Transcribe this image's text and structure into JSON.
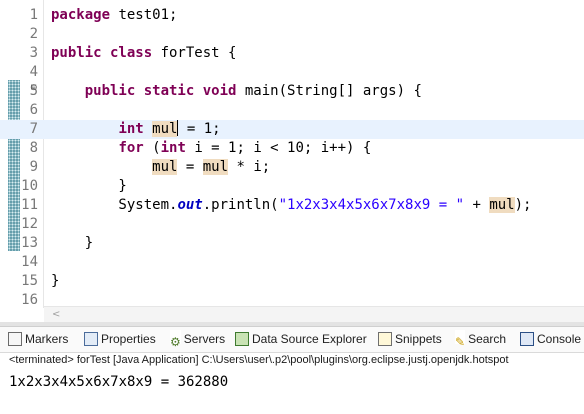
{
  "editor": {
    "lines": [
      {
        "n": "1",
        "parts": [
          {
            "t": "package ",
            "c": "kw"
          },
          {
            "t": "test01;"
          }
        ]
      },
      {
        "n": "2",
        "parts": []
      },
      {
        "n": "3",
        "parts": [
          {
            "t": "public class ",
            "c": "kw"
          },
          {
            "t": "forTest {"
          }
        ]
      },
      {
        "n": "4",
        "parts": []
      },
      {
        "n": "5",
        "fold": "⊖",
        "parts": [
          {
            "t": "    "
          },
          {
            "t": "public static void ",
            "c": "kw"
          },
          {
            "t": "main(String[] args) {"
          }
        ]
      },
      {
        "n": "6",
        "parts": []
      },
      {
        "n": "7",
        "current": true,
        "parts": [
          {
            "t": "        "
          },
          {
            "t": "int ",
            "c": "kw"
          },
          {
            "t": "mul",
            "c": "occ",
            "caret": true
          },
          {
            "t": " = 1;"
          }
        ]
      },
      {
        "n": "8",
        "parts": [
          {
            "t": "        "
          },
          {
            "t": "for ",
            "c": "kw"
          },
          {
            "t": "("
          },
          {
            "t": "int ",
            "c": "kw"
          },
          {
            "t": "i = 1; i < 10; i++) {"
          }
        ]
      },
      {
        "n": "9",
        "parts": [
          {
            "t": "            "
          },
          {
            "t": "mul",
            "c": "occ"
          },
          {
            "t": " = "
          },
          {
            "t": "mul",
            "c": "occ"
          },
          {
            "t": " * i;"
          }
        ]
      },
      {
        "n": "10",
        "parts": [
          {
            "t": "        }"
          }
        ]
      },
      {
        "n": "11",
        "parts": [
          {
            "t": "        System."
          },
          {
            "t": "out",
            "c": "fld"
          },
          {
            "t": ".println("
          },
          {
            "t": "\"1x2x3x4x5x6x7x8x9 = \"",
            "c": "str"
          },
          {
            "t": " + "
          },
          {
            "t": "mul",
            "c": "occ"
          },
          {
            "t": ");"
          }
        ]
      },
      {
        "n": "12",
        "parts": []
      },
      {
        "n": "13",
        "parts": [
          {
            "t": "    }"
          }
        ]
      },
      {
        "n": "14",
        "parts": []
      },
      {
        "n": "15",
        "parts": [
          {
            "t": "}"
          }
        ]
      },
      {
        "n": "16",
        "parts": []
      }
    ],
    "scroll_left_glyph": "<"
  },
  "views": {
    "tabs": [
      {
        "label": "Markers",
        "icon": "markers-icon"
      },
      {
        "label": "Properties",
        "icon": "properties-icon"
      },
      {
        "label": "Servers",
        "icon": "servers-icon"
      },
      {
        "label": "Data Source Explorer",
        "icon": "data-source-explorer-icon"
      },
      {
        "label": "Snippets",
        "icon": "snippets-icon"
      },
      {
        "label": "Search",
        "icon": "search-icon"
      },
      {
        "label": "Console",
        "icon": "console-icon"
      }
    ],
    "status": "<terminated> forTest [Java Application] C:\\Users\\user\\.p2\\pool\\plugins\\org.eclipse.justj.openjdk.hotspot",
    "console_output": "1x2x3x4x5x6x7x8x9 = 362880"
  }
}
